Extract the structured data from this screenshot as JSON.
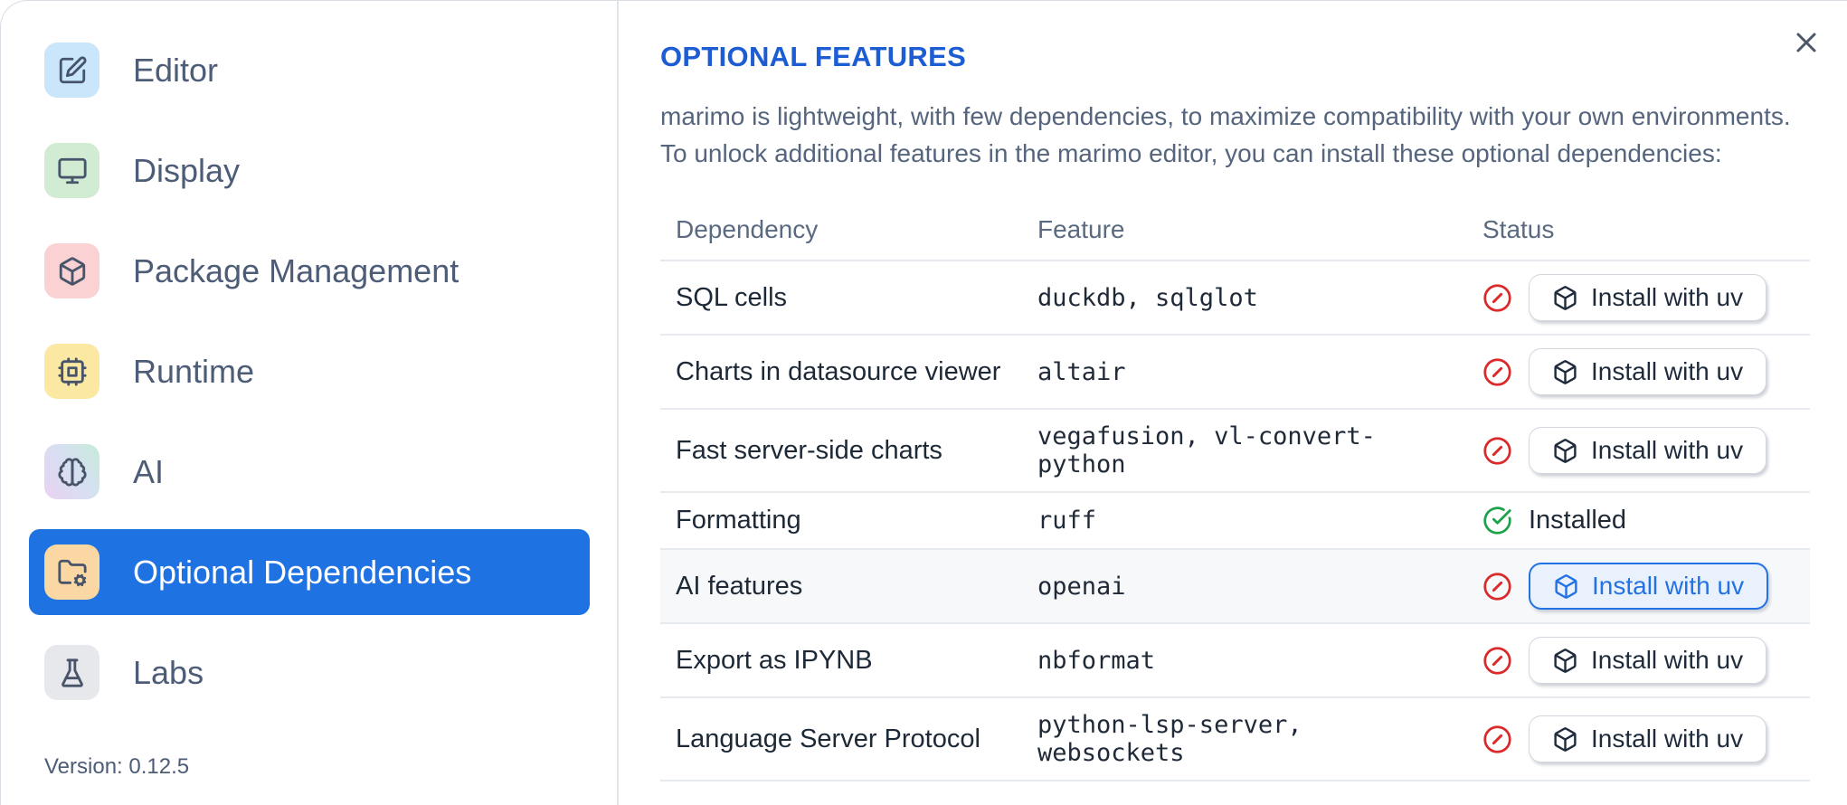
{
  "sidebar": {
    "items": [
      {
        "label": "Editor",
        "icon": "edit-icon",
        "icon_bg": "#c9e6fa",
        "selected": false
      },
      {
        "label": "Display",
        "icon": "monitor-icon",
        "icon_bg": "#d2ebd3",
        "selected": false
      },
      {
        "label": "Package Management",
        "icon": "package-icon",
        "icon_bg": "#fbd2d3",
        "selected": false
      },
      {
        "label": "Runtime",
        "icon": "cpu-icon",
        "icon_bg": "#fae8a3",
        "selected": false
      },
      {
        "label": "AI",
        "icon": "brain-icon",
        "icon_bg": "gradient(#e9d2f3,#c6ead9)",
        "selected": false
      },
      {
        "label": "Optional Dependencies",
        "icon": "folder-cog-icon",
        "icon_bg": "#fbd8a3",
        "selected": true
      },
      {
        "label": "Labs",
        "icon": "flask-icon",
        "icon_bg": "#e7e8eb",
        "selected": false
      }
    ],
    "version": "Version: 0.12.5"
  },
  "panel": {
    "title": "OPTIONAL FEATURES",
    "description_line1": "marimo is lightweight, with few dependencies, to maximize compatibility with your own environments.",
    "description_line2": "To unlock additional features in the marimo editor, you can install these optional dependencies:",
    "close_icon": "x-icon"
  },
  "table": {
    "headers": [
      "Dependency",
      "Feature",
      "Status"
    ],
    "install_button_label": "Install with uv",
    "installed_label": "Installed",
    "rows": [
      {
        "dependency": "SQL cells",
        "feature": "duckdb, sqlglot",
        "installed": false,
        "highlighted": false
      },
      {
        "dependency": "Charts in datasource viewer",
        "feature": "altair",
        "installed": false,
        "highlighted": false
      },
      {
        "dependency": "Fast server-side charts",
        "feature": "vegafusion, vl-convert-python",
        "installed": false,
        "highlighted": false
      },
      {
        "dependency": "Formatting",
        "feature": "ruff",
        "installed": true,
        "highlighted": false
      },
      {
        "dependency": "AI features",
        "feature": "openai",
        "installed": false,
        "highlighted": true
      },
      {
        "dependency": "Export as IPYNB",
        "feature": "nbformat",
        "installed": false,
        "highlighted": false
      },
      {
        "dependency": "Language Server Protocol",
        "feature": "python-lsp-server, websockets",
        "installed": false,
        "highlighted": false
      }
    ]
  },
  "colors": {
    "accent_blue": "#1f72e2",
    "title_blue": "#1c5dd3",
    "status_red": "#d92b2b",
    "status_green": "#1da24c",
    "text_dark": "#1d2937",
    "text_slate": "#55657e"
  }
}
